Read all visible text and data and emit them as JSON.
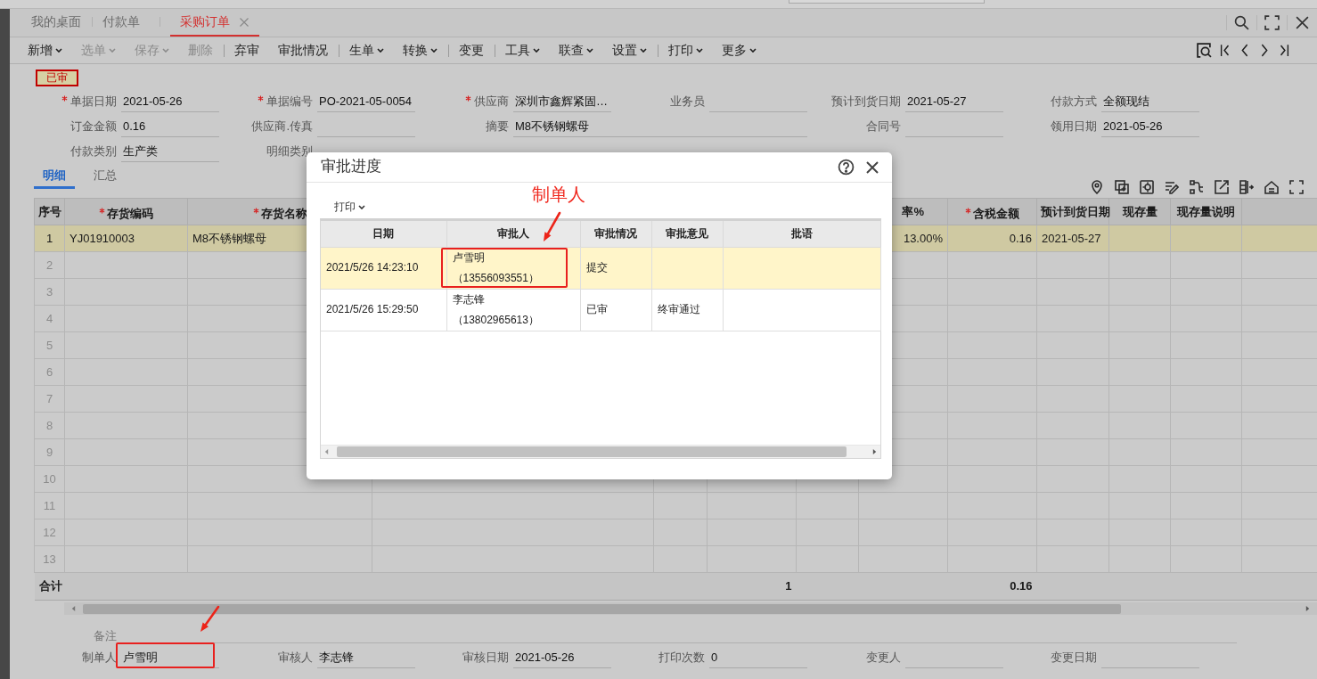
{
  "tabs": [
    {
      "label": "我的桌面",
      "selected": false,
      "closable": false
    },
    {
      "label": "付款单",
      "selected": false,
      "closable": false
    },
    {
      "label": "采购订单",
      "selected": true,
      "closable": true
    }
  ],
  "toolbar": [
    {
      "kind": "button",
      "label": "新增",
      "dropdown": true,
      "disabled": false
    },
    {
      "kind": "button",
      "label": "选单",
      "dropdown": true,
      "disabled": true
    },
    {
      "kind": "button",
      "label": "保存",
      "dropdown": true,
      "disabled": true
    },
    {
      "kind": "button",
      "label": "删除",
      "dropdown": false,
      "disabled": true
    },
    {
      "kind": "separator"
    },
    {
      "kind": "button",
      "label": "弃审",
      "dropdown": false,
      "disabled": false
    },
    {
      "kind": "button",
      "label": "审批情况",
      "dropdown": false,
      "disabled": false
    },
    {
      "kind": "separator"
    },
    {
      "kind": "button",
      "label": "生单",
      "dropdown": true,
      "disabled": false
    },
    {
      "kind": "button",
      "label": "转换",
      "dropdown": true,
      "disabled": false
    },
    {
      "kind": "separator"
    },
    {
      "kind": "button",
      "label": "变更",
      "dropdown": false,
      "disabled": false
    },
    {
      "kind": "separator"
    },
    {
      "kind": "button",
      "label": "工具",
      "dropdown": true,
      "disabled": false
    },
    {
      "kind": "button",
      "label": "联查",
      "dropdown": true,
      "disabled": false
    },
    {
      "kind": "button",
      "label": "设置",
      "dropdown": true,
      "disabled": false
    },
    {
      "kind": "separator"
    },
    {
      "kind": "button",
      "label": "打印",
      "dropdown": true,
      "disabled": false
    },
    {
      "kind": "button",
      "label": "更多",
      "dropdown": true,
      "disabled": false
    }
  ],
  "status_badge": "已审",
  "form": {
    "fields": [
      {
        "label": "单据日期",
        "required": true,
        "wide": false,
        "value": "2021-05-26"
      },
      {
        "label": "单据编号",
        "required": true,
        "wide": false,
        "value": "PO-2021-05-0054"
      },
      {
        "label": "供应商",
        "required": true,
        "wide": false,
        "value": "深圳市鑫辉紧固…"
      },
      {
        "label": "业务员",
        "required": false,
        "wide": false
      },
      {
        "label": "预计到货日期",
        "required": false,
        "wide": false,
        "value": "2021-05-27"
      },
      {
        "label": "付款方式",
        "required": false,
        "wide": false,
        "value": "全额现结"
      },
      {
        "label": "订金金额",
        "required": false,
        "wide": false,
        "value": "0.16"
      },
      {
        "label": "供应商.传真",
        "required": false,
        "wide": false
      },
      {
        "label": "摘要",
        "required": false,
        "wide": true,
        "value": "M8不锈钢螺母"
      },
      {
        "label": "合同号",
        "required": false,
        "wide": false
      },
      {
        "label": "领用日期",
        "required": false,
        "wide": false,
        "value": "2021-05-26"
      },
      {
        "label": "付款类别",
        "required": false,
        "wide": false,
        "value": "生产类"
      },
      {
        "label": "明细类别",
        "required": false
      }
    ]
  },
  "detail_tabs": [
    {
      "label": "明细",
      "selected": true
    },
    {
      "label": "汇总",
      "selected": false
    }
  ],
  "grid": {
    "columns": [
      {
        "label": "序号",
        "required": false
      },
      {
        "label": "存货编码",
        "required": true
      },
      {
        "label": "存货名称",
        "required": true
      },
      {
        "label": "率%",
        "required": false
      },
      {
        "label": "含税金额",
        "required": true
      },
      {
        "label": "预计到货日期",
        "required": false
      },
      {
        "label": "现存量",
        "required": false
      },
      {
        "label": "现存量说明",
        "required": false
      }
    ],
    "rows": [
      {
        "no": "1",
        "selected": true,
        "code": "YJ01910003",
        "name": "M8不锈钢螺母",
        "tax_rate": "13.00%",
        "amount": "0.16",
        "arrival_date": "2021-05-27"
      },
      {
        "no": "2",
        "selected": false
      },
      {
        "no": "3",
        "selected": false
      },
      {
        "no": "4",
        "selected": false
      },
      {
        "no": "5",
        "selected": false
      },
      {
        "no": "6",
        "selected": false
      },
      {
        "no": "7",
        "selected": false
      },
      {
        "no": "8",
        "selected": false
      },
      {
        "no": "9",
        "selected": false
      },
      {
        "no": "10",
        "selected": false
      },
      {
        "no": "11",
        "selected": false
      },
      {
        "no": "12",
        "selected": false
      },
      {
        "no": "13",
        "selected": false
      }
    ],
    "total": {
      "label": "合计",
      "quantity": "1",
      "amount": "0.16"
    }
  },
  "footer": {
    "remark_label": "备注",
    "fields": [
      {
        "label": "制单人",
        "value": "卢雪明"
      },
      {
        "label": "审核人",
        "value": "李志锋"
      },
      {
        "label": "审核日期",
        "value": "2021-05-26"
      },
      {
        "label": "打印次数",
        "value": "0"
      },
      {
        "label": "变更人"
      },
      {
        "label": "变更日期"
      }
    ]
  },
  "dialog": {
    "title": "审批进度",
    "toolbar": [
      {
        "label": "打印",
        "dropdown": true
      }
    ],
    "columns": [
      "日期",
      "审批人",
      "审批情况",
      "审批意见",
      "批语"
    ],
    "rows": [
      {
        "selected": true,
        "date": "2021/5/26 14:23:10",
        "approver": "卢雪明（13556093551）",
        "status": "提交"
      },
      {
        "selected": false,
        "date": "2021/5/26 15:29:50",
        "approver": "李志锋（13802965613）",
        "status": "已审",
        "opinion": "终审通过"
      }
    ]
  },
  "annotation": {
    "label": "制单人"
  }
}
